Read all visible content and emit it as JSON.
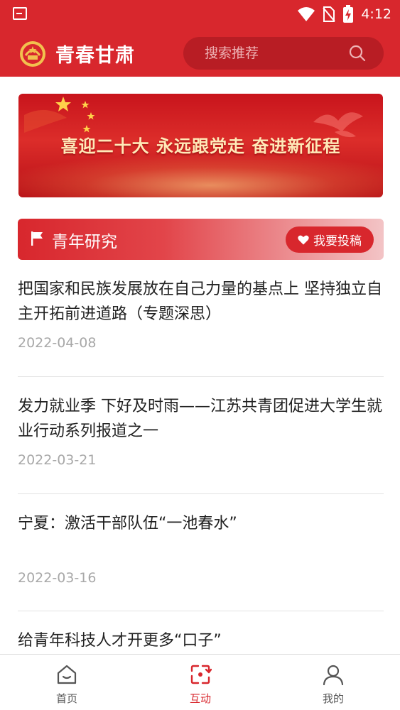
{
  "status_bar": {
    "time": "4:12",
    "icons": [
      "notification-icon",
      "wifi-icon",
      "no-sim-icon",
      "battery-charging-icon"
    ]
  },
  "app": {
    "title": "青春甘肃",
    "logo_icon": "youth-league-emblem-icon"
  },
  "search": {
    "placeholder": "搜索推荐",
    "icon": "search-icon"
  },
  "banner": {
    "text": "喜迎二十大  永远跟党走  奋进新征程"
  },
  "section": {
    "title": "青年研究",
    "icon": "flag-icon",
    "submit_label": "我要投稿",
    "submit_icon": "heart-icon"
  },
  "articles": [
    {
      "title": "把国家和民族发展放在自己力量的基点上 坚持独立自主开拓前进道路（专题深思）",
      "date": "2022-04-08"
    },
    {
      "title": "发力就业季 下好及时雨——江苏共青团促进大学生就业行动系列报道之一",
      "date": "2022-03-21"
    },
    {
      "title": "宁夏：激活干部队伍“一池春水”",
      "date": "2022-03-16"
    },
    {
      "title": "给青年科技人才开更多“口子”"
    }
  ],
  "tabbar": {
    "tabs": [
      {
        "label": "首页",
        "icon": "home-icon",
        "active": false
      },
      {
        "label": "互动",
        "icon": "interact-icon",
        "active": true
      },
      {
        "label": "我的",
        "icon": "person-icon",
        "active": false
      }
    ]
  },
  "colors": {
    "brand_red": "#d8272d",
    "search_bg": "#b81d24",
    "date_gray": "#a8a8a8",
    "divider": "#e3e3e3"
  }
}
